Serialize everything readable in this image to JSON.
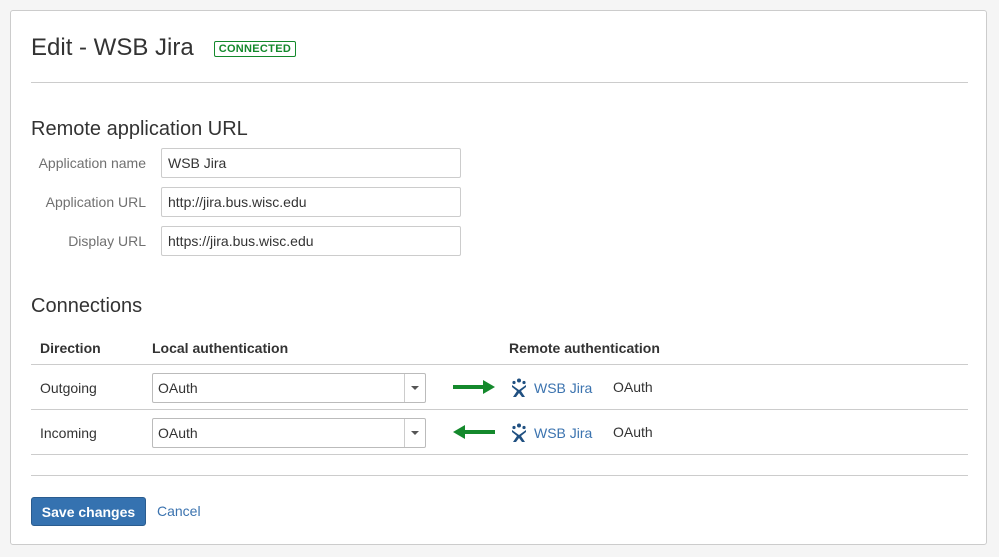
{
  "header": {
    "title": "Edit - WSB Jira",
    "status_badge": "CONNECTED"
  },
  "remote_app": {
    "section_title": "Remote application URL",
    "fields": [
      {
        "label": "Application name",
        "value": "WSB Jira"
      },
      {
        "label": "Application URL",
        "value": "http://jira.bus.wisc.edu"
      },
      {
        "label": "Display URL",
        "value": "https://jira.bus.wisc.edu"
      }
    ]
  },
  "connections": {
    "section_title": "Connections",
    "headers": {
      "direction": "Direction",
      "local": "Local authentication",
      "remote": "Remote authentication"
    },
    "rows": [
      {
        "direction": "Outgoing",
        "local_auth": "OAuth",
        "arrow": "arrow-right-icon",
        "remote_app": "WSB Jira",
        "remote_auth": "OAuth"
      },
      {
        "direction": "Incoming",
        "local_auth": "OAuth",
        "arrow": "arrow-left-icon",
        "remote_app": "WSB Jira",
        "remote_auth": "OAuth"
      }
    ]
  },
  "footer": {
    "save_label": "Save changes",
    "cancel_label": "Cancel"
  },
  "colors": {
    "primary": "#3572b0",
    "connected": "#14892c",
    "arrow": "#14892c",
    "link": "#3b73af"
  }
}
